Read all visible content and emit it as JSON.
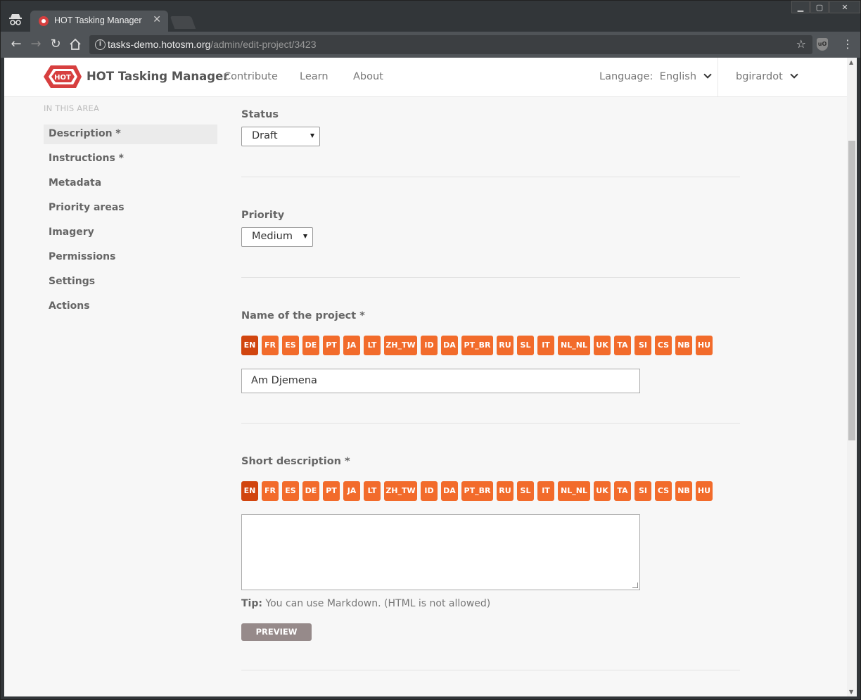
{
  "browser": {
    "tab_title": "HOT Tasking Manager",
    "tab_close": "✕",
    "url_host": "tasks-demo.hotosm.org",
    "url_path": "/admin/edit-project/3423"
  },
  "header": {
    "brand": "HOT Tasking Manager",
    "logo_text": "HOT",
    "nav": [
      "Contribute",
      "Learn",
      "About"
    ],
    "language_label": "Language:",
    "language_value": "English",
    "username": "bgirardot"
  },
  "sidebar": {
    "heading": "IN THIS AREA",
    "items": [
      "Description *",
      "Instructions *",
      "Metadata",
      "Priority areas",
      "Imagery",
      "Permissions",
      "Settings",
      "Actions"
    ],
    "active_index": 0
  },
  "form": {
    "status_label": "Status",
    "status_value": "Draft",
    "priority_label": "Priority",
    "priority_value": "Medium",
    "name_label": "Name of the project *",
    "name_value": "Am Djemena",
    "short_desc_label": "Short description *",
    "short_desc_value": "",
    "tip_label": "Tip:",
    "tip_text": " You can use Markdown. (HTML is not allowed)",
    "preview_label": "PREVIEW",
    "languages": [
      "EN",
      "FR",
      "ES",
      "DE",
      "PT",
      "JA",
      "LT",
      "ZH_TW",
      "ID",
      "DA",
      "PT_BR",
      "RU",
      "SL",
      "IT",
      "NL_NL",
      "UK",
      "TA",
      "SI",
      "CS",
      "NB",
      "HU"
    ],
    "active_language": "EN"
  },
  "colors": {
    "lang_button": "#f26b2b",
    "lang_button_active": "#d1450f",
    "preview_button": "#968a8a",
    "brand_red": "#d73f3f"
  }
}
